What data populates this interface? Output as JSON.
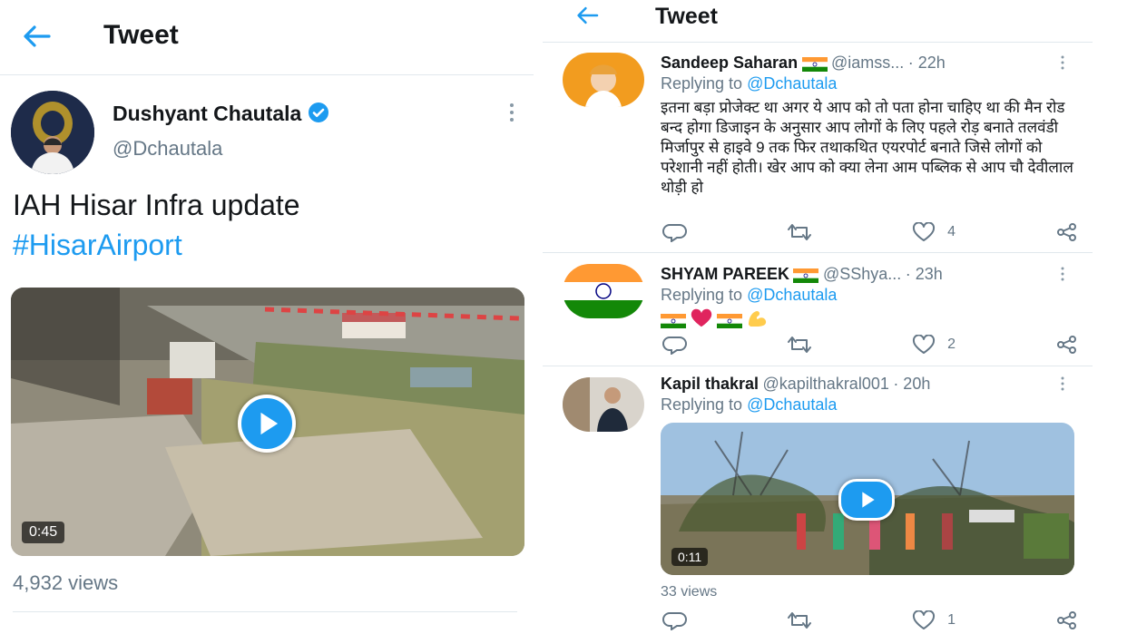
{
  "left": {
    "header_title": "Tweet",
    "author": {
      "name": "Dushyant Chautala",
      "handle": "@Dchautala"
    },
    "tweet_text": "IAH Hisar Infra update",
    "hashtag": "#HisarAirport",
    "video_duration": "0:45",
    "views": "4,932 views"
  },
  "right": {
    "header_title": "Tweet",
    "replies": [
      {
        "name": "Sandeep Saharan",
        "handle": "@iamss...",
        "time": "· 22h",
        "replying_prefix": "Replying to",
        "replying_to": "@Dchautala",
        "text": "इतना बड़ा प्रोजेक्ट था अगर ये आप को तो पता होना चाहिए था की मैन रोड बन्द होगा डिजाइन के अनुसार आप लोगों के लिए पहले रोड़ बनाते तलवंडी मिर्जापुर से हाइवे 9 तक फिर तथाकथित एयरपोर्ट बनाते जिसे लोगों को परेशानी नहीं होती। खेर आप को क्या लेना आम पब्लिक से आप चौ देवीलाल थोड़ी हो",
        "likes": "4"
      },
      {
        "name": "SHYAM PAREEK",
        "handle": "@SShya...",
        "time": "· 23h",
        "replying_prefix": "Replying to",
        "replying_to": "@Dchautala",
        "likes": "2"
      },
      {
        "name": "Kapil thakral",
        "handle": "@kapilthakral001",
        "time": "· 20h",
        "replying_prefix": "Replying to",
        "replying_to": "@Dchautala",
        "video_duration": "0:11",
        "views": "33 views",
        "likes": "1"
      }
    ]
  },
  "colors": {
    "accent": "#1d9bf0",
    "text": "#14171a",
    "muted": "#657786",
    "separator": "#e1e8ed"
  }
}
